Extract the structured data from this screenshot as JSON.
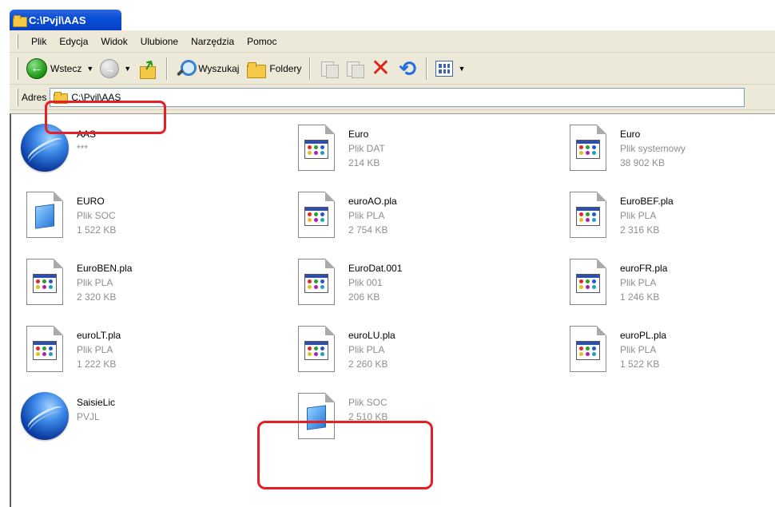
{
  "window": {
    "title": "C:\\Pvjl\\AAS"
  },
  "menu": [
    "Plik",
    "Edycja",
    "Widok",
    "Ulubione",
    "Narzędzia",
    "Pomoc"
  ],
  "toolbar": {
    "back_label": "Wstecz",
    "search_label": "Wyszukaj",
    "folders_label": "Foldery"
  },
  "address": {
    "label": "Adres",
    "value": "C:\\Pvjl\\AAS"
  },
  "files": [
    {
      "name": "AAS",
      "type": "***",
      "size": "",
      "icon": "globe-icon"
    },
    {
      "name": "Euro",
      "type": "Plik DAT",
      "size": "214 KB",
      "icon": "pla-file-icon"
    },
    {
      "name": "Euro",
      "type": "Plik systemowy",
      "size": "38 902 KB",
      "icon": "pla-file-icon"
    },
    {
      "name": "EURO",
      "type": "Plik SOC",
      "size": "1 522 KB",
      "icon": "soc-file-icon"
    },
    {
      "name": "euroAO.pla",
      "type": "Plik PLA",
      "size": "2 754 KB",
      "icon": "pla-file-icon"
    },
    {
      "name": "EuroBEF.pla",
      "type": "Plik PLA",
      "size": "2 316 KB",
      "icon": "pla-file-icon"
    },
    {
      "name": "EuroBEN.pla",
      "type": "Plik PLA",
      "size": "2 320 KB",
      "icon": "pla-file-icon"
    },
    {
      "name": "EuroDat.001",
      "type": "Plik 001",
      "size": "206 KB",
      "icon": "pla-file-icon"
    },
    {
      "name": "euroFR.pla",
      "type": "Plik PLA",
      "size": "1 246 KB",
      "icon": "pla-file-icon"
    },
    {
      "name": "euroLT.pla",
      "type": "Plik PLA",
      "size": "1 222 KB",
      "icon": "pla-file-icon"
    },
    {
      "name": "euroLU.pla",
      "type": "Plik PLA",
      "size": "2 260 KB",
      "icon": "pla-file-icon"
    },
    {
      "name": "euroPL.pla",
      "type": "Plik PLA",
      "size": "1 522 KB",
      "icon": "pla-file-icon"
    },
    {
      "name": "SaisieLic",
      "type": "PVJL",
      "size": "",
      "icon": "globe-icon"
    },
    {
      "name": "",
      "type": "Plik SOC",
      "size": "2 510 KB",
      "icon": "soc-file-icon"
    }
  ],
  "colors": {
    "highlight": "#e81e25",
    "titlebar": "#0a4fd6"
  }
}
